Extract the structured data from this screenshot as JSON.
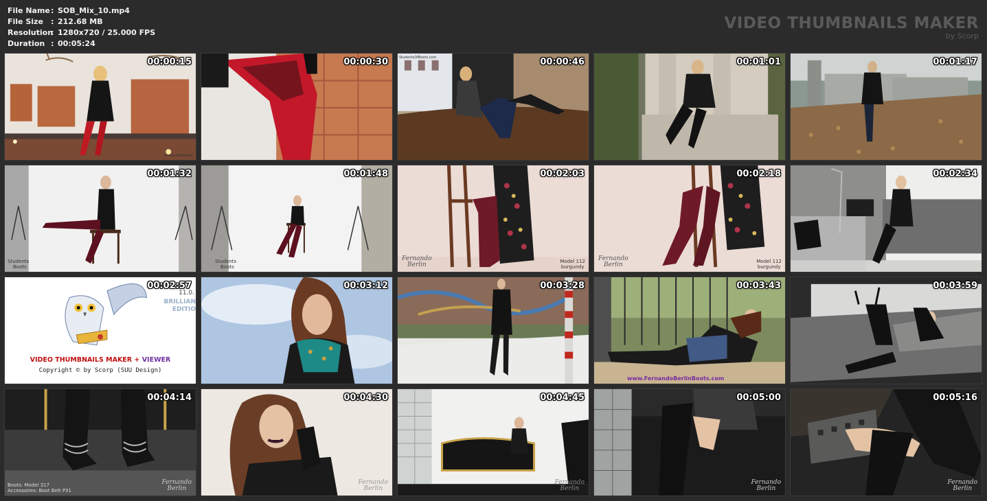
{
  "info": {
    "rows": [
      {
        "key": "File Name",
        "value": "SOB_Mix_10.mp4"
      },
      {
        "key": "File Size",
        "value": "212.68 MB"
      },
      {
        "key": "Resolution",
        "value": "1280x720 / 25.000 FPS"
      },
      {
        "key": "Duration",
        "value": "00:05:24"
      }
    ],
    "separator": ":"
  },
  "brand": {
    "title": "VIDEO THUMBNAILS MAKER",
    "subtitle": "by Scorp"
  },
  "timestamps": [
    "00:00:15",
    "00:00:30",
    "00:00:46",
    "00:01:01",
    "00:01:17",
    "00:01:32",
    "00:01:48",
    "00:02:03",
    "00:02:18",
    "00:02:34",
    "00:02:57",
    "00:03:12",
    "00:03:28",
    "00:03:43",
    "00:03:59",
    "00:04:14",
    "00:04:30",
    "00:04:45",
    "00:05:00",
    "00:05:16"
  ],
  "splash": {
    "title_part1": "VIDEO THUMBNAILS MAKER",
    "title_plus": "+",
    "title_part2": "VIEWER",
    "copyright": "Copyright © by Scorp (SUU Design)",
    "version": "11.0.",
    "edition_line1": "BRILLIAN",
    "edition_line2": "EDITIO"
  },
  "watermarks": {
    "t1": "StudentsOfBoots",
    "t3": "StudentsOfBoots.com",
    "t6_line1": "Students",
    "t6_line2": "Boots",
    "t7_line1": "Students",
    "t7_line2": "Boots",
    "fb_line1": "Fernando",
    "fb_line2": "Berlin",
    "t8_model_line1": "Model 112",
    "t8_model_line2": "burgundy",
    "t9_model_line1": "Model 112",
    "t9_model_line2": "burgundy",
    "t14_url": "www.FernandoBerlinBoots.com",
    "t16_line1": "Boots: Model 317",
    "t16_line2": "Accessoires: Boot Belt P31"
  }
}
